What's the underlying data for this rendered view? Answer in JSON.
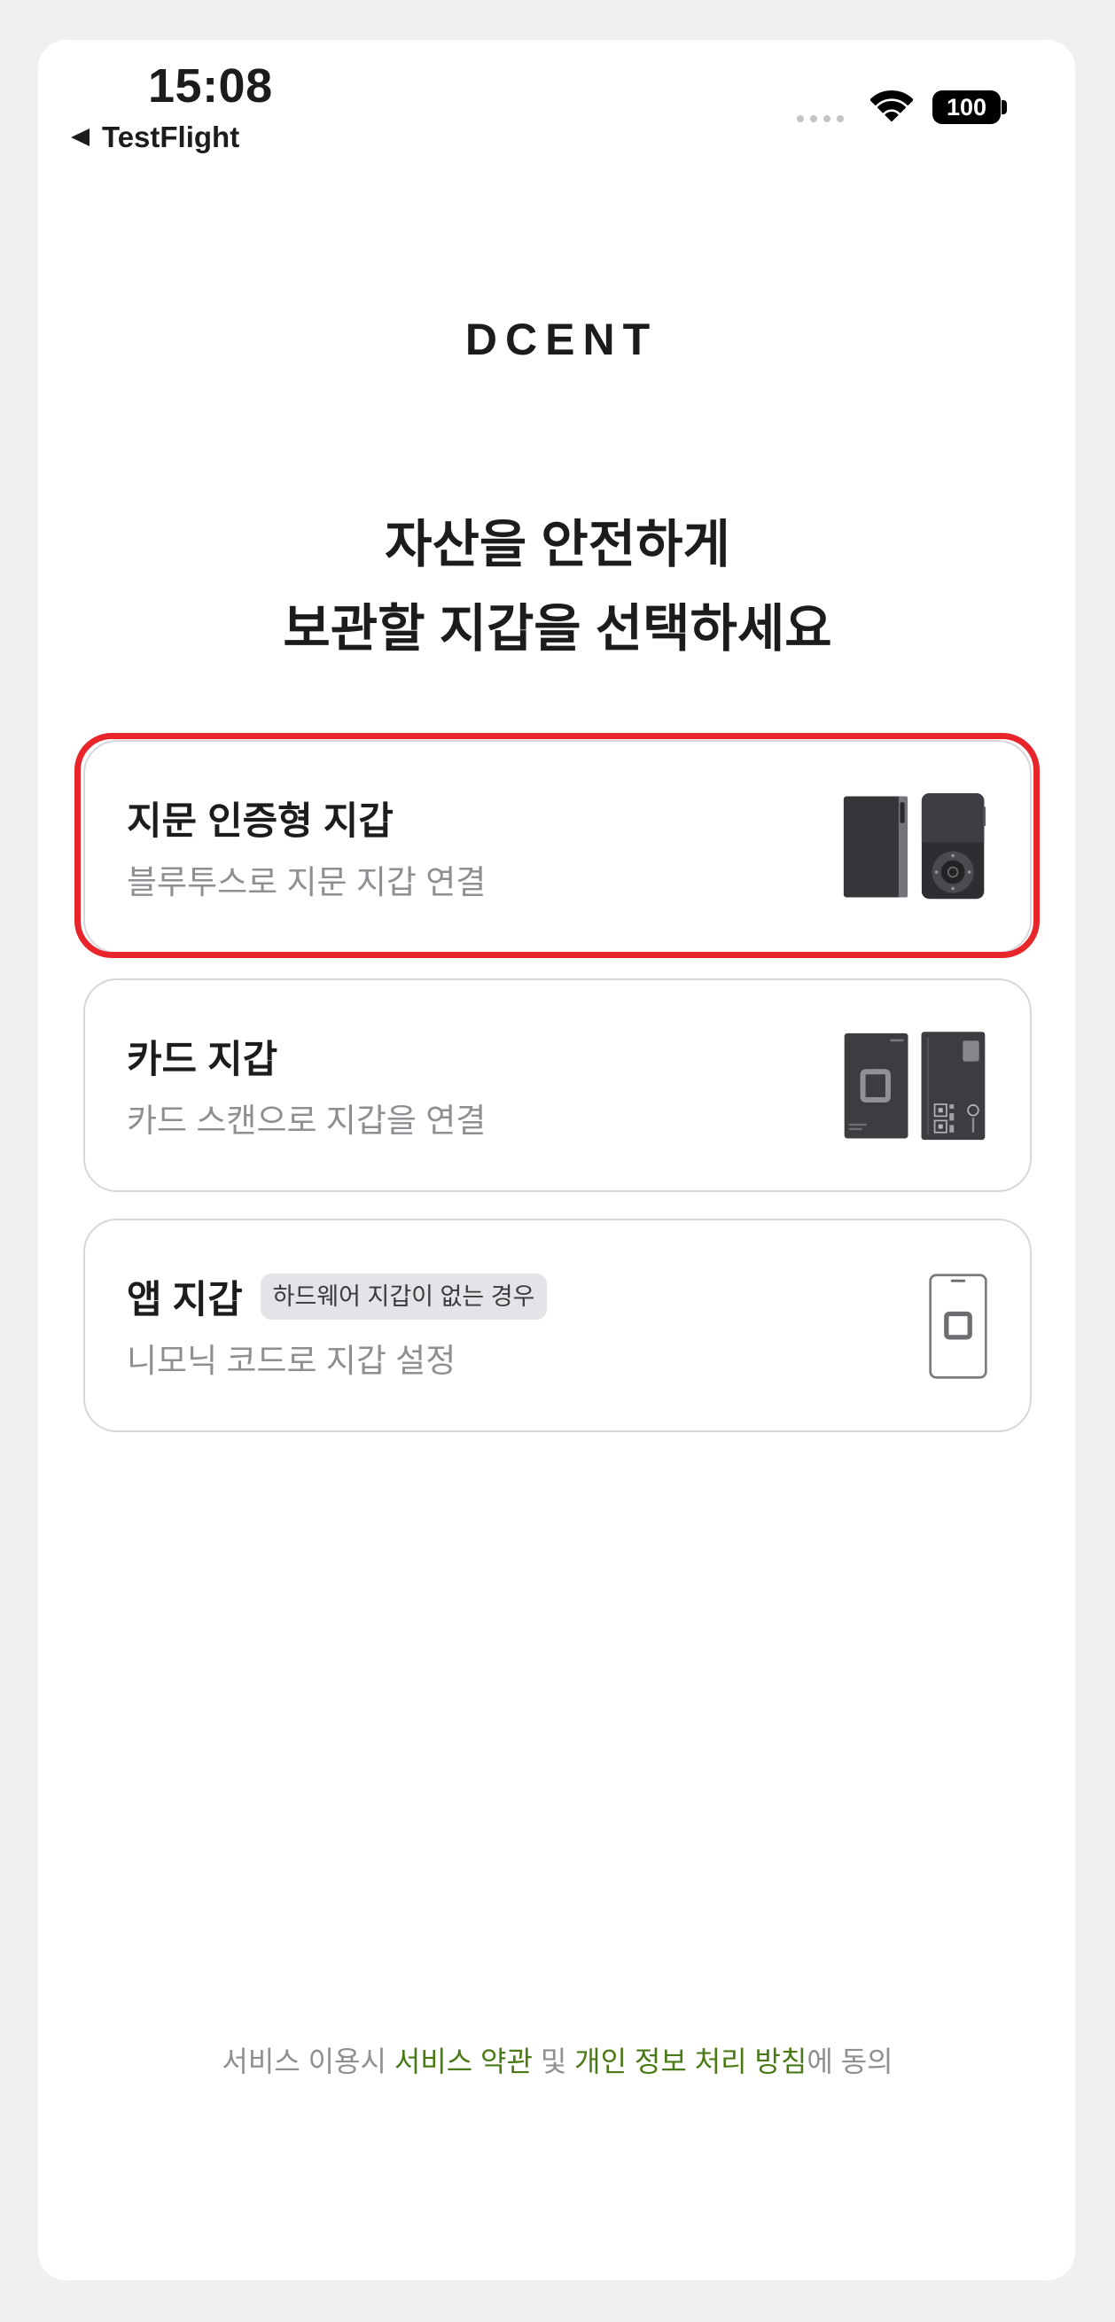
{
  "status_bar": {
    "time": "15:08",
    "back_label": "TestFlight",
    "battery_level": "100",
    "icons": [
      "back-triangle-icon",
      "cellular-dots-icon",
      "wifi-icon",
      "battery-icon"
    ]
  },
  "brand": {
    "logo_text": "DCENT"
  },
  "heading": {
    "line1": "자산을 안전하게",
    "line2": "보관할 지갑을 선택하세요"
  },
  "wallet_options": [
    {
      "title": "지문 인증형 지갑",
      "subtitle": "블루투스로 지문 지갑 연결",
      "icon": "biometric-wallet-device-icon",
      "highlighted": true
    },
    {
      "title": "카드 지갑",
      "subtitle": "카드 스캔으로 지갑을 연결",
      "icon": "card-wallet-icon",
      "highlighted": false
    },
    {
      "title": "앱 지갑",
      "badge": "하드웨어 지갑이 없는 경우",
      "subtitle": "니모닉 코드로 지갑 설정",
      "icon": "phone-app-wallet-icon",
      "highlighted": false
    }
  ],
  "footer": {
    "prefix": "서비스 이용시 ",
    "terms_link": "서비스 약관",
    "conjunction": " 및 ",
    "privacy_link": "개인 정보 처리 방침",
    "suffix": "에 동의"
  },
  "colors": {
    "background": "#f0f0f2",
    "surface": "#ffffff",
    "text_primary": "#1c1c1e",
    "text_secondary": "#8e8e93",
    "link_green": "#4a7a16",
    "highlight_red": "#e8252b",
    "card_border": "#d7d7db",
    "badge_background": "#e4e4e8"
  }
}
